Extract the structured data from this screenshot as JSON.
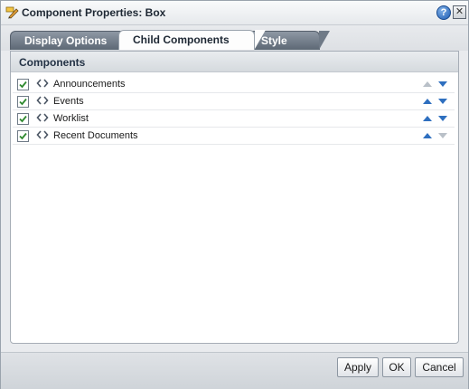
{
  "dialog": {
    "title": "Component Properties: Box",
    "help_icon": "help-icon",
    "close_icon": "close-icon"
  },
  "tabs": [
    {
      "label": "Display Options",
      "selected": false
    },
    {
      "label": "Child Components",
      "selected": true
    },
    {
      "label": "Style",
      "selected": false
    }
  ],
  "section": {
    "title": "Components"
  },
  "components": [
    {
      "label": "Announcements",
      "checked": true,
      "up_enabled": false,
      "down_enabled": true
    },
    {
      "label": "Events",
      "checked": true,
      "up_enabled": true,
      "down_enabled": true
    },
    {
      "label": "Worklist",
      "checked": true,
      "up_enabled": true,
      "down_enabled": true
    },
    {
      "label": "Recent Documents",
      "checked": true,
      "up_enabled": true,
      "down_enabled": false
    }
  ],
  "footer": {
    "apply_label": "Apply",
    "ok_label": "OK",
    "cancel_label": "Cancel"
  },
  "colors": {
    "arrow_enabled": "#2e6fbf",
    "arrow_disabled": "#b9c0c8",
    "check": "#2f8a2f",
    "tab_inactive": "#6f7a87"
  }
}
